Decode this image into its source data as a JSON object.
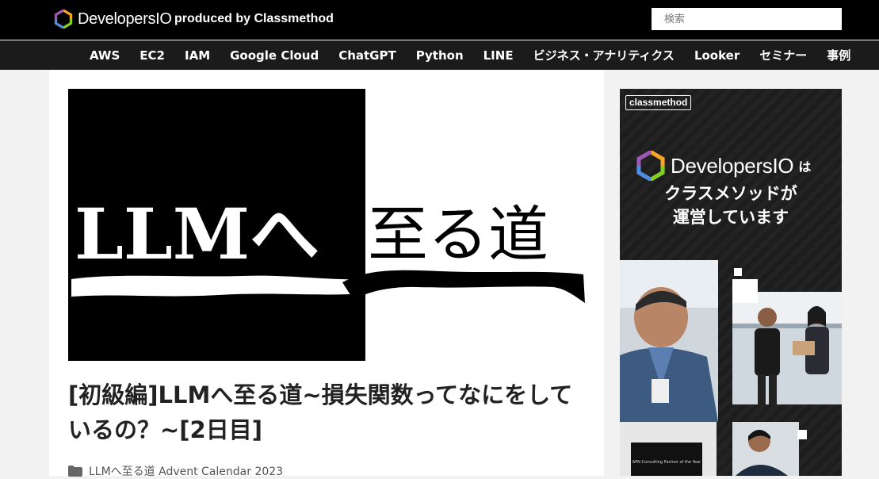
{
  "header": {
    "brand_name": "DevelopersIO",
    "tagline": "produced by Classmethod",
    "search_placeholder": "検索"
  },
  "nav": {
    "items": [
      "AWS",
      "EC2",
      "IAM",
      "Google Cloud",
      "ChatGPT",
      "Python",
      "LINE",
      "ビジネス・アナリティクス",
      "Looker",
      "セミナー",
      "事例"
    ]
  },
  "article": {
    "hero_text_left": "LLMへ",
    "hero_text_right": "至る道",
    "title": "[初級編]LLMへ至る道~損失関数ってなにをしているの？~[2日目]",
    "category": "LLMへ至る道 Advent Calendar 2023"
  },
  "ad": {
    "badge": "classmethod",
    "brand_name": "DevelopersIO",
    "brand_suffix": "は",
    "line1": "クラスメソッドが",
    "line2": "運営しています",
    "award_text": "APN Consulting Partner of the Year"
  },
  "colors": {
    "header_bg": "#000000",
    "nav_bg": "#1b1b1b",
    "page_bg": "#f2f2f2",
    "ad_bg": "#1e1e1e"
  }
}
